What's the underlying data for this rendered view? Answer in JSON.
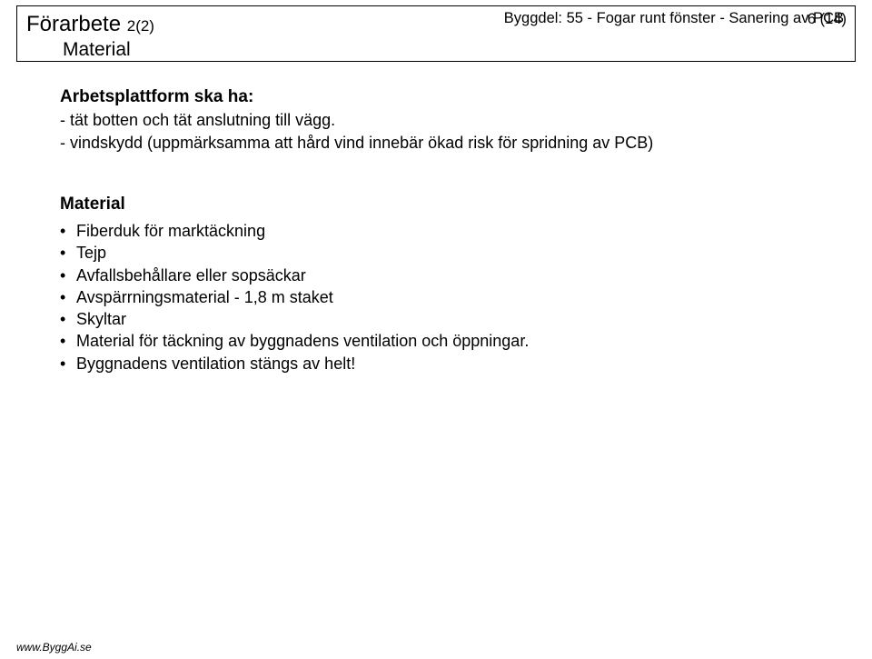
{
  "page_number": "6 (14)",
  "header": {
    "title": "Förarbete",
    "count": "2(2)",
    "subtitle": "Material",
    "byggdel": "Byggdel: 55 - Fogar runt fönster - Sanering av PCB"
  },
  "platform": {
    "heading": "Arbetsplattform ska ha:",
    "line1": "- tät botten och tät anslutning till vägg.",
    "line2": "- vindskydd (uppmärksamma att hård vind innebär ökad risk för spridning av PCB)"
  },
  "material": {
    "heading": "Material",
    "items": [
      "Fiberduk för marktäckning",
      "Tejp",
      "Avfallsbehållare eller sopsäckar",
      "Avspärrningsmaterial - 1,8 m staket",
      "Skyltar",
      "Material för täckning av byggnadens ventilation och öppningar.",
      "Byggnadens ventilation stängs av helt!"
    ]
  },
  "footer": "www.ByggAi.se"
}
